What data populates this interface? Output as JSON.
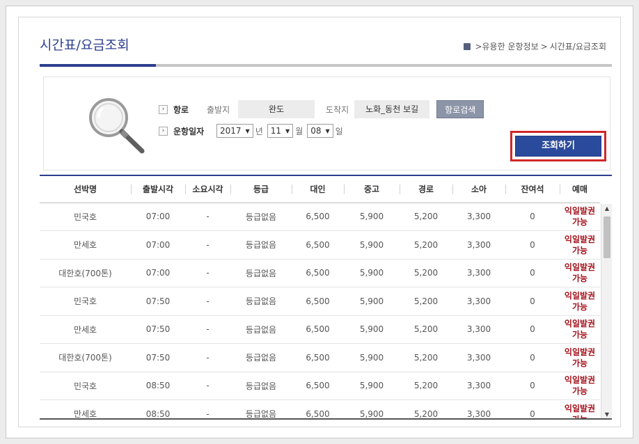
{
  "header": {
    "title": "시간표/요금조회",
    "breadcrumb": [
      ">유용한 운항정보",
      ">",
      "시간표/요금조회"
    ]
  },
  "search": {
    "route_label": "항로",
    "departure_label": "출발지",
    "departure_value": "완도",
    "arrival_label": "도착지",
    "arrival_value": "노화_동천 보길",
    "route_search_button": "항로검색",
    "date_label": "운항일자",
    "year": "2017",
    "year_unit": "년",
    "month": "11",
    "month_unit": "월",
    "day": "08",
    "day_unit": "일",
    "query_button": "조회하기"
  },
  "table": {
    "columns": [
      "선박명",
      "출발시각",
      "소요시각",
      "등급",
      "대인",
      "중고",
      "경로",
      "소아",
      "잔여석",
      "예매"
    ],
    "rows": [
      [
        "민국호",
        "07:00",
        "-",
        "등급없음",
        "6,500",
        "5,900",
        "5,200",
        "3,300",
        "0",
        "익일발권 가능"
      ],
      [
        "만세호",
        "07:00",
        "-",
        "등급없음",
        "6,500",
        "5,900",
        "5,200",
        "3,300",
        "0",
        "익일발권 가능"
      ],
      [
        "대한호(700톤)",
        "07:00",
        "-",
        "등급없음",
        "6,500",
        "5,900",
        "5,200",
        "3,300",
        "0",
        "익일발권 가능"
      ],
      [
        "민국호",
        "07:50",
        "-",
        "등급없음",
        "6,500",
        "5,900",
        "5,200",
        "3,300",
        "0",
        "익일발권 가능"
      ],
      [
        "만세호",
        "07:50",
        "-",
        "등급없음",
        "6,500",
        "5,900",
        "5,200",
        "3,300",
        "0",
        "익일발권 가능"
      ],
      [
        "대한호(700톤)",
        "07:50",
        "-",
        "등급없음",
        "6,500",
        "5,900",
        "5,200",
        "3,300",
        "0",
        "익일발권 가능"
      ],
      [
        "민국호",
        "08:50",
        "-",
        "등급없음",
        "6,500",
        "5,900",
        "5,200",
        "3,300",
        "0",
        "익일발권 가능"
      ],
      [
        "만세호",
        "08:50",
        "-",
        "등급없음",
        "6,500",
        "5,900",
        "5,200",
        "3,300",
        "0",
        "익일발권 가능"
      ]
    ]
  },
  "colors": {
    "brand": "#2d3f8f",
    "query_button": "#2a4b9c",
    "highlight_border": "#d12727",
    "reservation_text": "#a2101a"
  }
}
